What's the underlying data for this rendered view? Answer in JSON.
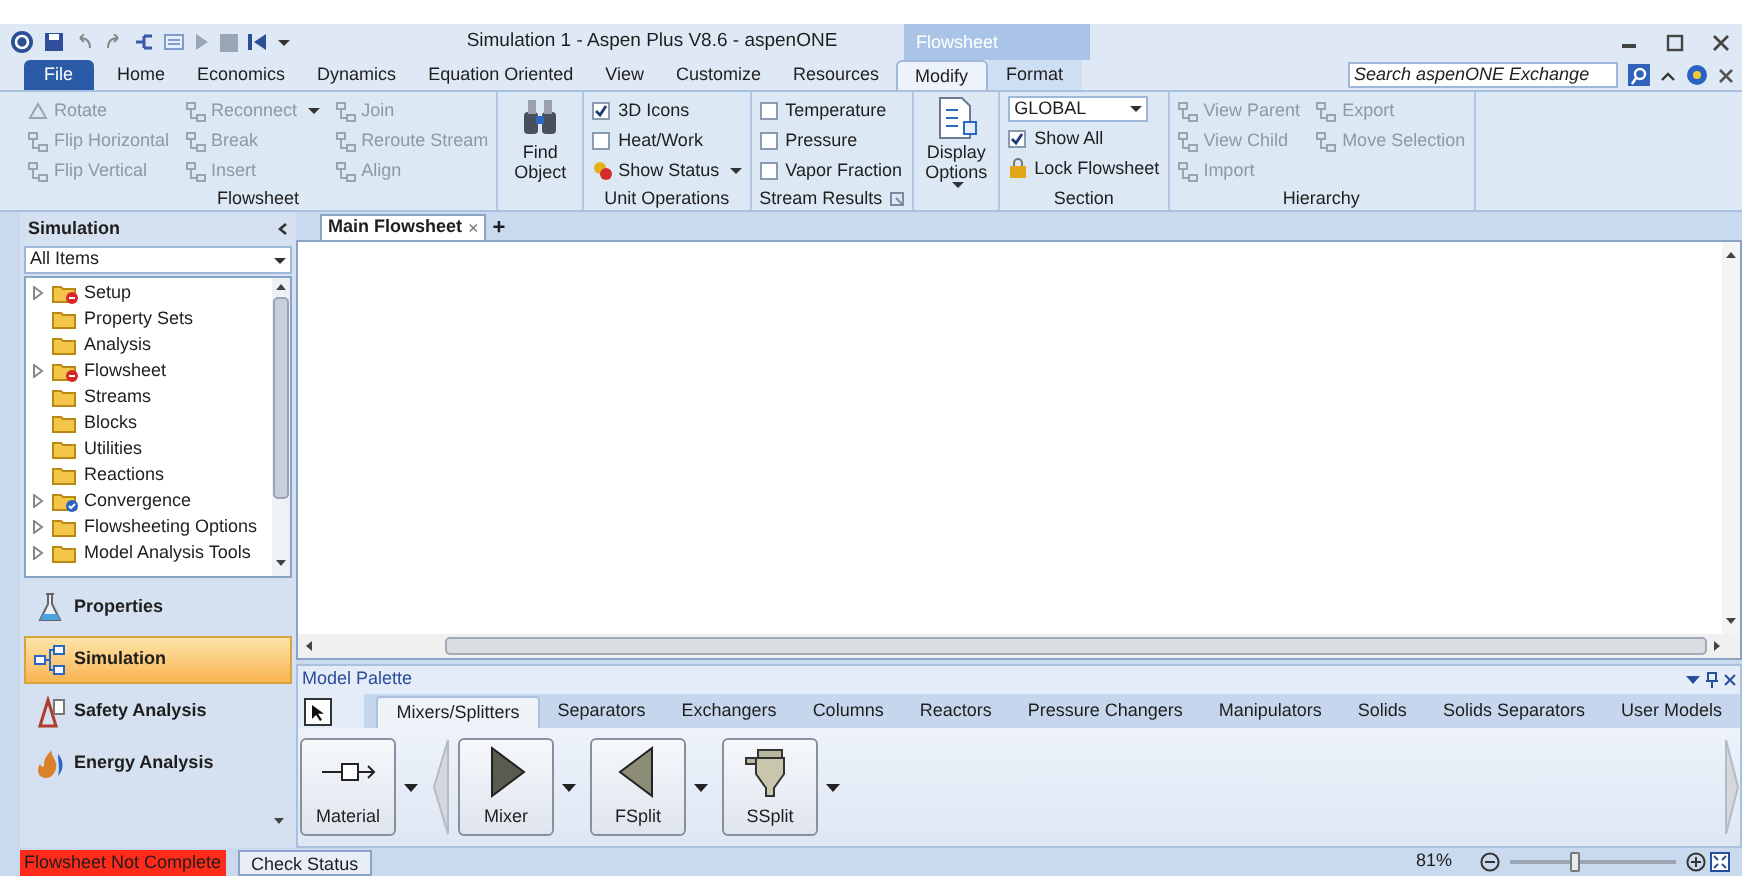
{
  "title_bar": {
    "title": "Simulation 1 - Aspen Plus V8.6 - aspenONE",
    "tab_group": "Flowsheet"
  },
  "ribbon_tabs": [
    {
      "label": "File",
      "selected": false,
      "kind": "file"
    },
    {
      "label": "Home",
      "selected": false,
      "kind": "tab"
    },
    {
      "label": "Economics",
      "selected": false,
      "kind": "tab"
    },
    {
      "label": "Dynamics",
      "selected": false,
      "kind": "tab"
    },
    {
      "label": "Equation Oriented",
      "selected": false,
      "kind": "tab"
    },
    {
      "label": "View",
      "selected": false,
      "kind": "tab"
    },
    {
      "label": "Customize",
      "selected": false,
      "kind": "tab"
    },
    {
      "label": "Resources",
      "selected": false,
      "kind": "tab"
    },
    {
      "label": "Modify",
      "selected": true,
      "kind": "context"
    },
    {
      "label": "Format",
      "selected": false,
      "kind": "context"
    }
  ],
  "search": {
    "placeholder": "Search aspenONE Exchange"
  },
  "ribbon_groups": [
    {
      "label": "Flowsheet",
      "columns": [
        [
          {
            "kind": "command",
            "label": "Rotate",
            "disabled": true
          },
          {
            "kind": "command",
            "label": "Flip Horizontal",
            "disabled": true
          },
          {
            "kind": "command",
            "label": "Flip Vertical",
            "disabled": true
          }
        ],
        [
          {
            "kind": "command",
            "label": "Reconnect",
            "disabled": true,
            "menu": true
          },
          {
            "kind": "command",
            "label": "Break",
            "disabled": true
          },
          {
            "kind": "command",
            "label": "Insert",
            "disabled": true
          }
        ],
        [
          {
            "kind": "command",
            "label": "Join",
            "disabled": true
          },
          {
            "kind": "command",
            "label": "Reroute Stream",
            "disabled": true
          },
          {
            "kind": "command",
            "label": "Align",
            "disabled": true
          }
        ]
      ]
    },
    {
      "columns": [
        [
          {
            "kind": "large",
            "label": "Find Object"
          }
        ]
      ]
    },
    {
      "label": "Unit Operations",
      "columns": [
        [
          {
            "kind": "checkbox",
            "label": "3D Icons",
            "checked": true
          },
          {
            "kind": "checkbox",
            "label": "Heat/Work",
            "checked": false
          },
          {
            "kind": "command",
            "label": "Show Status",
            "disabled": false,
            "menu": true
          }
        ]
      ]
    },
    {
      "label": "Stream Results",
      "launcher": true,
      "columns": [
        [
          {
            "kind": "checkbox",
            "label": "Temperature",
            "checked": false
          },
          {
            "kind": "checkbox",
            "label": "Pressure",
            "checked": false
          },
          {
            "kind": "checkbox",
            "label": "Vapor Fraction",
            "checked": false
          }
        ]
      ]
    },
    {
      "columns": [
        [
          {
            "kind": "large",
            "label": "Display Options",
            "menu": true
          }
        ]
      ]
    },
    {
      "label": "Section",
      "columns": [
        [
          {
            "kind": "dropdown",
            "value": "GLOBAL"
          },
          {
            "kind": "checkbox",
            "label": "Show All",
            "checked": true
          },
          {
            "kind": "command",
            "label": "Lock Flowsheet",
            "disabled": false
          }
        ]
      ]
    },
    {
      "label": "Hierarchy",
      "columns": [
        [
          {
            "kind": "command",
            "label": "View Parent",
            "disabled": true
          },
          {
            "kind": "command",
            "label": "View Child",
            "disabled": true
          },
          {
            "kind": "command",
            "label": "Import",
            "disabled": true
          }
        ],
        [
          {
            "kind": "command",
            "label": "Export",
            "disabled": true
          },
          {
            "kind": "command",
            "label": "Move Selection",
            "disabled": true
          }
        ]
      ]
    }
  ],
  "navigation": {
    "title": "Simulation",
    "filter": "All Items",
    "tree": [
      {
        "label": "Setup",
        "expander": true,
        "error": true,
        "verified": false
      },
      {
        "label": "Property Sets",
        "expander": false
      },
      {
        "label": "Analysis",
        "expander": false
      },
      {
        "label": "Flowsheet",
        "expander": true,
        "error": true,
        "verified": false
      },
      {
        "label": "Streams",
        "expander": false
      },
      {
        "label": "Blocks",
        "expander": false
      },
      {
        "label": "Utilities",
        "expander": false
      },
      {
        "label": "Reactions",
        "expander": false
      },
      {
        "label": "Convergence",
        "expander": true,
        "error": false,
        "verified": true
      },
      {
        "label": "Flowsheeting Options",
        "expander": true
      },
      {
        "label": "Model Analysis Tools",
        "expander": true
      }
    ],
    "buttons": [
      {
        "label": "Properties",
        "selected": false
      },
      {
        "label": "Simulation",
        "selected": true
      },
      {
        "label": "Safety Analysis",
        "selected": false
      },
      {
        "label": "Energy Analysis",
        "selected": false
      }
    ]
  },
  "document_tabs": [
    {
      "label": "Main Flowsheet",
      "selected": true,
      "close": "×"
    }
  ],
  "new_tab": "+",
  "model_palette": {
    "title": "Model Palette",
    "tabs": [
      {
        "label": "Mixers/Splitters",
        "selected": true
      },
      {
        "label": "Separators",
        "selected": false
      },
      {
        "label": "Exchangers",
        "selected": false
      },
      {
        "label": "Columns",
        "selected": false
      },
      {
        "label": "Reactors",
        "selected": false
      },
      {
        "label": "Pressure Changers",
        "selected": false
      },
      {
        "label": "Manipulators",
        "selected": false
      },
      {
        "label": "Solids",
        "selected": false
      },
      {
        "label": "Solids Separators",
        "selected": false
      },
      {
        "label": "User Models",
        "selected": false
      }
    ],
    "blocks": [
      {
        "label": "Material",
        "kind": "material"
      },
      {
        "label": "Mixer",
        "kind": "mixer"
      },
      {
        "label": "FSplit",
        "kind": "fsplit"
      },
      {
        "label": "SSplit",
        "kind": "ssplit"
      }
    ]
  },
  "status_bar": {
    "message": "Flowsheet Not Complete",
    "check_button": "Check Status",
    "zoom": "81%",
    "zoom_slider": {
      "level": 0.39
    }
  }
}
